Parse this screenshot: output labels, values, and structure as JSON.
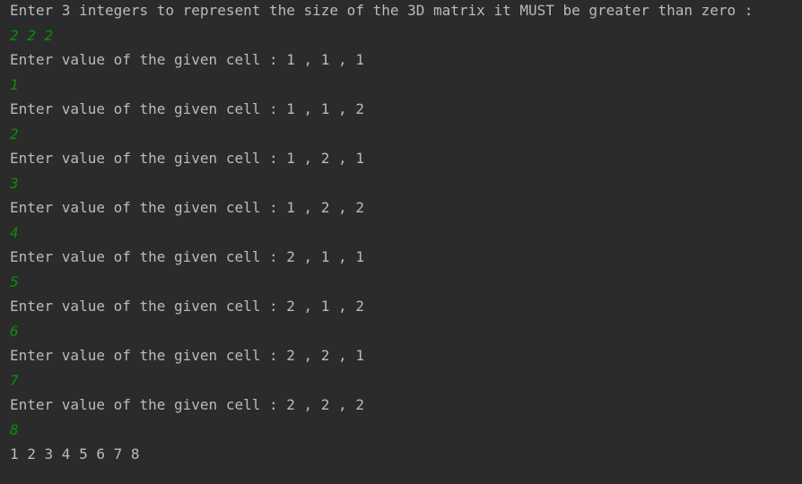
{
  "console": {
    "lines": [
      {
        "type": "output",
        "text": "Enter 3 integers to represent the size of the 3D matrix it MUST be greater than zero :"
      },
      {
        "type": "input",
        "text": "2 2 2"
      },
      {
        "type": "output",
        "text": "Enter value of the given cell : 1 , 1 , 1"
      },
      {
        "type": "input",
        "text": "1"
      },
      {
        "type": "output",
        "text": "Enter value of the given cell : 1 , 1 , 2"
      },
      {
        "type": "input",
        "text": "2"
      },
      {
        "type": "output",
        "text": "Enter value of the given cell : 1 , 2 , 1"
      },
      {
        "type": "input",
        "text": "3"
      },
      {
        "type": "output",
        "text": "Enter value of the given cell : 1 , 2 , 2"
      },
      {
        "type": "input",
        "text": "4"
      },
      {
        "type": "output",
        "text": "Enter value of the given cell : 2 , 1 , 1"
      },
      {
        "type": "input",
        "text": "5"
      },
      {
        "type": "output",
        "text": "Enter value of the given cell : 2 , 1 , 2"
      },
      {
        "type": "input",
        "text": "6"
      },
      {
        "type": "output",
        "text": "Enter value of the given cell : 2 , 2 , 1"
      },
      {
        "type": "input",
        "text": "7"
      },
      {
        "type": "output",
        "text": "Enter value of the given cell : 2 , 2 , 2"
      },
      {
        "type": "input",
        "text": "8"
      },
      {
        "type": "output",
        "text": "1 2 3 4 5 6 7 8"
      }
    ]
  },
  "colors": {
    "background": "#2b2b2b",
    "output_text": "#bbbbbb",
    "input_text": "#0e8c0e"
  }
}
